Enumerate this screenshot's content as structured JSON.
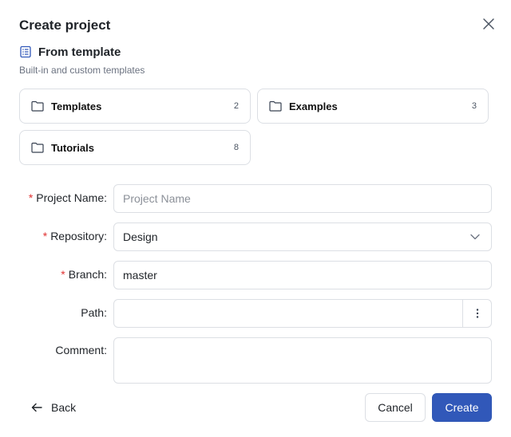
{
  "dialog": {
    "title": "Create project",
    "close_icon": "close-icon"
  },
  "template_section": {
    "icon": "list-icon",
    "title": "From template",
    "subtitle": "Built-in and custom templates",
    "folders": [
      {
        "label": "Templates",
        "count": "2",
        "icon": "folder-icon"
      },
      {
        "label": "Examples",
        "count": "3",
        "icon": "folder-icon"
      },
      {
        "label": "Tutorials",
        "count": "8",
        "icon": "folder-icon"
      }
    ]
  },
  "form": {
    "required_mark": "*",
    "project_name": {
      "label": "Project Name:",
      "value": "",
      "placeholder": "Project Name",
      "required": true
    },
    "repository": {
      "label": "Repository:",
      "value": "Design",
      "required": true,
      "icon": "chevron-down-icon"
    },
    "branch": {
      "label": "Branch:",
      "value": "master",
      "required": true
    },
    "path": {
      "label": "Path:",
      "value": "",
      "required": false,
      "icon": "more-vertical-icon"
    },
    "comment": {
      "label": "Comment:",
      "value": "",
      "required": false
    }
  },
  "footer": {
    "back_label": "Back",
    "back_icon": "arrow-left-icon",
    "cancel_label": "Cancel",
    "create_label": "Create"
  },
  "colors": {
    "primary": "#3158b9",
    "required": "#e03131",
    "border": "#dcdfe4"
  }
}
